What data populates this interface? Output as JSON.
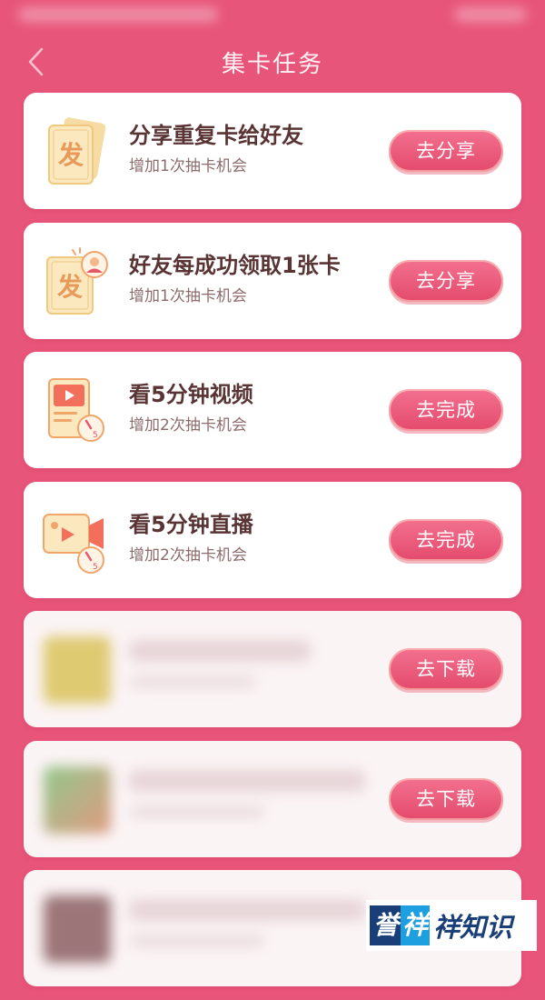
{
  "header": {
    "title": "集卡任务",
    "back_icon": "chevron-left-icon"
  },
  "tasks": [
    {
      "title": "分享重复卡给好友",
      "subtitle": "增加1次抽卡机会",
      "button": "去分享",
      "icon": "fa-card-icon"
    },
    {
      "title": "好友每成功领取1张卡",
      "subtitle": "增加1次抽卡机会",
      "button": "去分享",
      "icon": "fa-card-friend-icon"
    },
    {
      "title": "看5分钟视频",
      "subtitle": "增加2次抽卡机会",
      "button": "去完成",
      "icon": "video-timer-icon"
    },
    {
      "title": "看5分钟直播",
      "subtitle": "增加2次抽卡机会",
      "button": "去完成",
      "icon": "live-camera-timer-icon"
    },
    {
      "title": "",
      "subtitle": "",
      "button": "去下载",
      "icon": "app-thumbnail-icon"
    },
    {
      "title": "",
      "subtitle": "",
      "button": "去下载",
      "icon": "app-thumbnail-icon"
    },
    {
      "title": "",
      "subtitle": "",
      "button": "",
      "icon": "app-thumbnail-icon"
    }
  ],
  "watermark": {
    "part1": "誉",
    "part2": "祥",
    "part3": "祥知识"
  },
  "colors": {
    "background": "#e8557a",
    "button": "#e44a6c",
    "title_text": "#5a3434",
    "subtitle_text": "#8c6b6b"
  }
}
